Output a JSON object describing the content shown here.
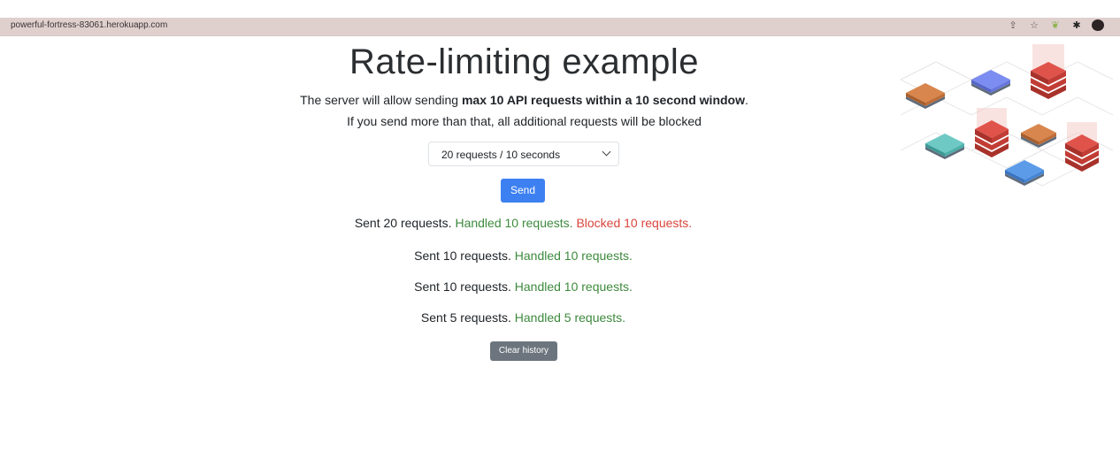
{
  "browser": {
    "url": "powerful-fortress-83061.herokuapp.com",
    "icons": [
      "share-icon",
      "star-icon",
      "extension-icon",
      "puzzle-icon",
      "profile-avatar"
    ]
  },
  "page": {
    "title": "Rate-limiting example",
    "desc_prefix": "The server will allow sending ",
    "desc_bold": "max 10 API requests within a 10 second window",
    "desc_suffix": ".",
    "desc_line2": "If you send more than that, all additional requests will be blocked",
    "select_value": "20 requests / 10 seconds",
    "send_label": "Send",
    "clear_label": "Clear history"
  },
  "results": [
    {
      "sent": "Sent 20 requests.",
      "handled": "Handled 10 requests.",
      "blocked": "Blocked 10 requests."
    },
    {
      "sent": "Sent 10 requests.",
      "handled": "Handled 10 requests.",
      "blocked": ""
    },
    {
      "sent": "Sent 10 requests.",
      "handled": "Handled 10 requests.",
      "blocked": ""
    },
    {
      "sent": "Sent 5 requests.",
      "handled": "Handled 5 requests.",
      "blocked": ""
    }
  ],
  "colors": {
    "handled": "#3d8a3d",
    "blocked": "#d9453d",
    "send_button": "#3d80f1",
    "clear_button": "#6c757d",
    "url_bar": "#dfd0ce"
  }
}
